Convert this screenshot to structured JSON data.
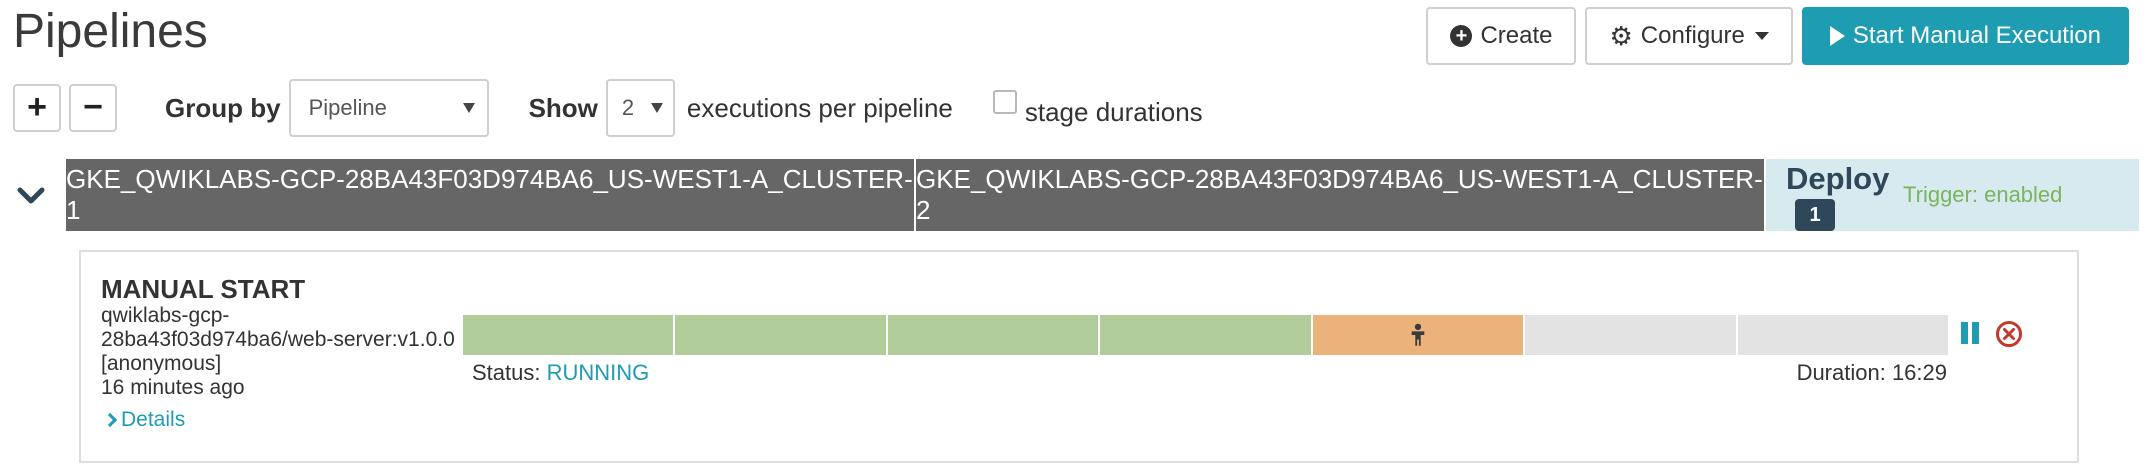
{
  "page": {
    "title": "Pipelines"
  },
  "actions": {
    "create": "Create",
    "configure": "Configure",
    "start_manual": "Start Manual Execution"
  },
  "controls": {
    "expand_icon": "plus-icon",
    "collapse_icon": "minus-icon",
    "group_by_label": "Group by",
    "group_by_value": "Pipeline",
    "show_label": "Show",
    "show_value": "2",
    "executions_text": "executions per pipeline",
    "stage_durations_label": "stage durations",
    "stage_durations_checked": false
  },
  "pipeline_group": {
    "clusters": [
      "GKE_QWIKLABS-GCP-28BA43F03D974BA6_US-WEST1-A_CLUSTER-1",
      "GKE_QWIKLABS-GCP-28BA43F03D974BA6_US-WEST1-A_CLUSTER-2"
    ],
    "pipeline": {
      "name": "Deploy",
      "count": "1",
      "trigger": "Trigger: enabled"
    }
  },
  "execution": {
    "title": "MANUAL START",
    "artifact": "qwiklabs-gcp-28ba43f03d974ba6/web-server:v1.0.0",
    "user": "[anonymous]",
    "time_ago": "16 minutes ago",
    "details_label": "Details",
    "status_label": "Status:",
    "status": "RUNNING",
    "duration": "Duration: 16:29",
    "stages": [
      {
        "state": "succeeded",
        "icon": ""
      },
      {
        "state": "succeeded",
        "icon": ""
      },
      {
        "state": "succeeded",
        "icon": ""
      },
      {
        "state": "succeeded",
        "icon": ""
      },
      {
        "state": "running",
        "icon": "person-icon"
      },
      {
        "state": "not-started",
        "icon": ""
      },
      {
        "state": "not-started",
        "icon": ""
      }
    ]
  },
  "colors": {
    "primary": "#1e9db2",
    "stage_succeeded": "#b1cd9c",
    "stage_running": "#ebb27b",
    "stage_not_started": "#e3e3e3",
    "cluster_header": "#666666",
    "deploy_header": "#d6eaf0",
    "deploy_text": "#2e4759",
    "trigger_text": "#7cb45b",
    "cancel": "#c0392b"
  }
}
